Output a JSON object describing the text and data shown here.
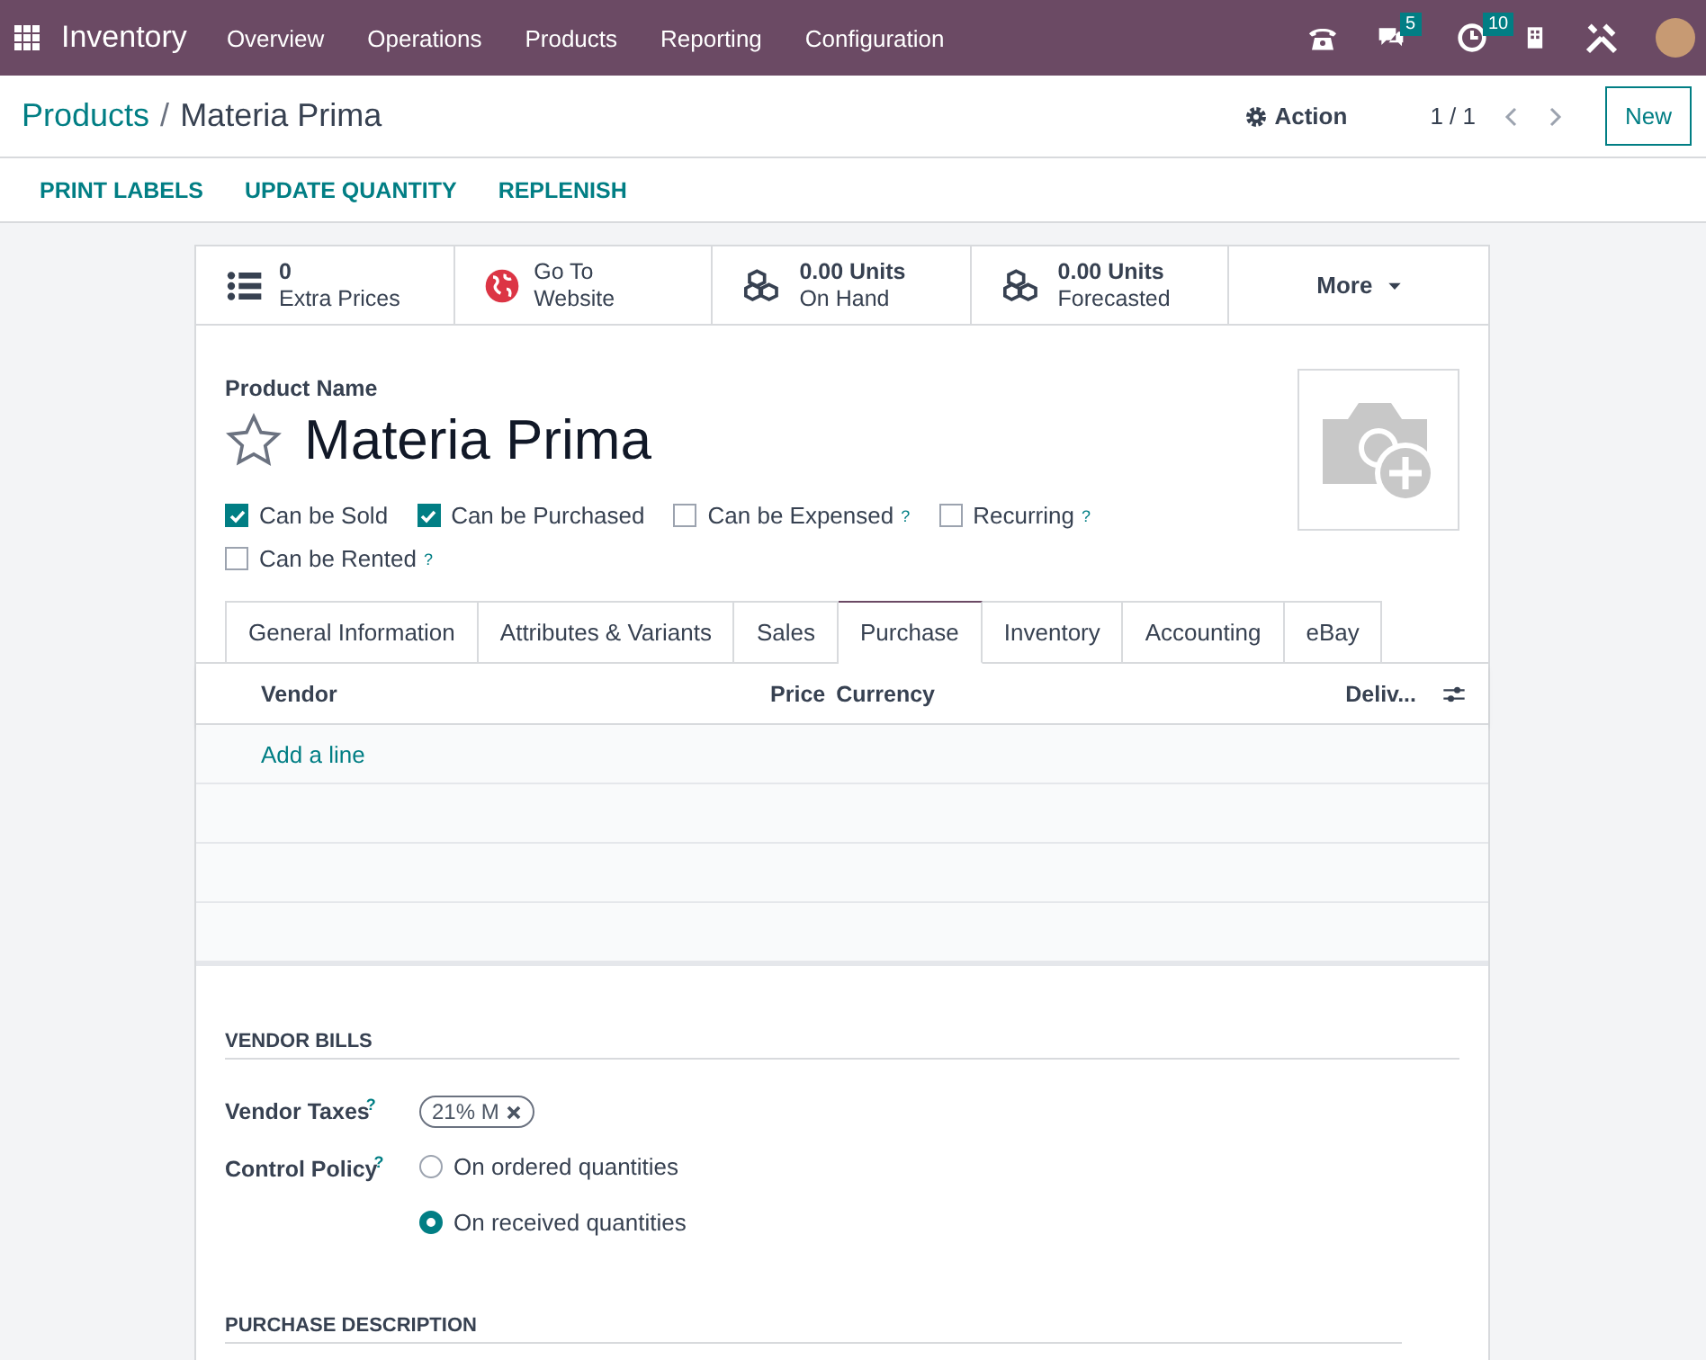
{
  "navbar": {
    "app_name": "Inventory",
    "menu": [
      "Overview",
      "Operations",
      "Products",
      "Reporting",
      "Configuration"
    ],
    "messages_count": "5",
    "activities_count": "10"
  },
  "control_panel": {
    "breadcrumb": [
      "Products",
      "Materia Prima"
    ],
    "breadcrumb_separator": "/",
    "action": "Action",
    "pager": "1 / 1",
    "new_button": "New"
  },
  "action_buttons": [
    "PRINT LABELS",
    "UPDATE QUANTITY",
    "REPLENISH"
  ],
  "stat_buttons": [
    {
      "kind": "list",
      "line_1": "0",
      "line_2": "Extra Prices"
    },
    {
      "kind": "website",
      "line_1": "Go To",
      "line_2": "Website"
    },
    {
      "kind": "cubes",
      "line_1": "0.00 Units",
      "line_2": "On Hand"
    },
    {
      "kind": "cubes",
      "line_1": "0.00 Units",
      "line_2": "Forecasted"
    },
    {
      "kind": "more",
      "line_1": "More"
    }
  ],
  "product": {
    "label": "Product Name",
    "name": "Materia Prima",
    "favorite": false
  },
  "options": [
    {
      "label": "Can be Sold",
      "checked": true
    },
    {
      "label": "Can be Purchased",
      "checked": true
    },
    {
      "label": "Can be Expensed",
      "checked": false,
      "help": "?"
    },
    {
      "label": "Recurring",
      "checked": false,
      "help": "?"
    },
    {
      "label": "Can be Rented",
      "checked": false,
      "help": "?"
    }
  ],
  "tabs": [
    {
      "label": "General Information",
      "selected": false
    },
    {
      "label": "Attributes & Variants",
      "selected": false
    },
    {
      "label": "Sales",
      "selected": false
    },
    {
      "label": "Purchase",
      "selected": true
    },
    {
      "label": "Inventory",
      "selected": false
    },
    {
      "label": "Accounting",
      "selected": false
    },
    {
      "label": "eBay",
      "selected": false
    }
  ],
  "vendor_table": {
    "columns": [
      "Vendor",
      "Price",
      "Currency",
      "Deliv..."
    ],
    "add_line": "Add a line"
  },
  "vendor_bills": {
    "title": "VENDOR BILLS",
    "taxes_label": "Vendor Taxes",
    "taxes_help": "?",
    "taxes": [
      "21% M"
    ],
    "policy_label": "Control Policy",
    "policy_help": "?",
    "policy_options": [
      {
        "label": "On ordered quantities",
        "selected": false
      },
      {
        "label": "On received quantities",
        "selected": true
      }
    ]
  },
  "purchase_description": {
    "title": "PURCHASE DESCRIPTION"
  }
}
